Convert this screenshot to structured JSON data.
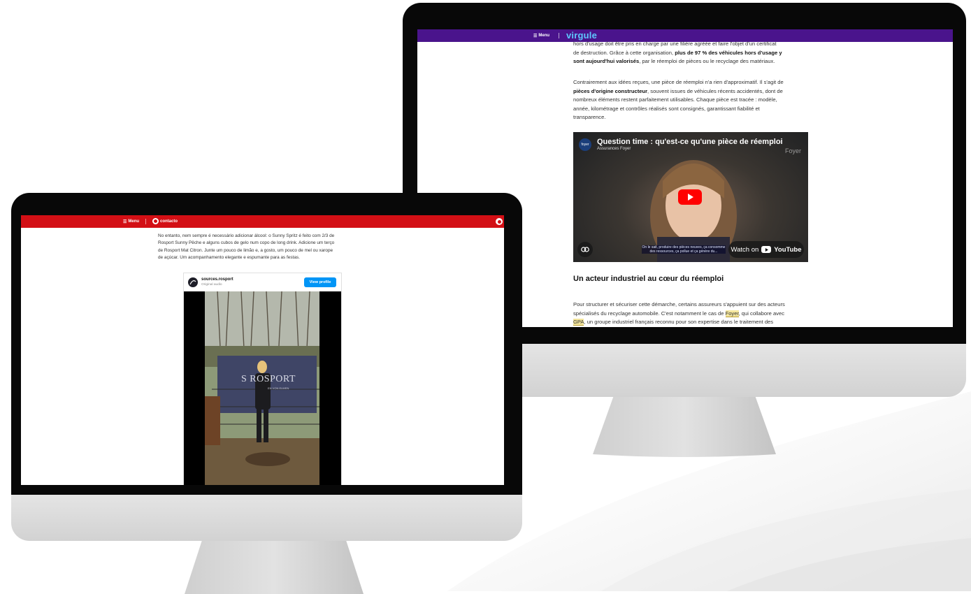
{
  "right_screen": {
    "header": {
      "menu_label": "Menu",
      "logo_text": "virgule",
      "brand_color": "#4a148c"
    },
    "article": {
      "p1": {
        "lines": [
          "hors d'usage doit être pris en charge par une filière agréée et faire l'objet d'un certificat",
          "de destruction. Grâce à cette organisation, "
        ],
        "bold_1": "plus de 97 % des véhicules hors d'usage y",
        "bold_2": "sont aujourd'hui valorisés",
        "end": ", par le réemploi de pièces ou le recyclage des matériaux."
      },
      "p2": {
        "start": "Contrairement aux idées reçues, une pièce de réemploi n'a rien d'approximatif. Il s'agit de",
        "bold": "pièces d'origine constructeur",
        "rest_1": ", souvent issues de véhicules récents accidentés, dont de",
        "line3": "nombreux éléments restent parfaitement utilisables. Chaque pièce est tracée : modèle,",
        "line4": "année, kilométrage et contrôles réalisés sont consignés, garantissant fiabilité et",
        "line5": "transparence."
      },
      "video": {
        "title": "Question time : qu'est-ce qu'une pièce de réemploi",
        "channel": "Assurances Foyer",
        "channel_logo": "foyer",
        "watermark": "Foyer",
        "caption_1": "On le sait, produire des pièces neuves, ça consomme",
        "caption_2": "des ressources, ça pollue et ça génère du...",
        "watch_label": "Watch on",
        "youtube_label": "YouTube"
      },
      "heading": "Un acteur industriel au cœur du réemploi",
      "p3": {
        "line1": "Pour structurer et sécuriser cette démarche, certains assureurs s'appuient sur des acteurs",
        "line2_a": "spécialisés du recyclage automobile. C'est notamment le cas de ",
        "link_foyer": "Foyer",
        "line2_b": ", qui collabore avec",
        "link_gpa": "GPA",
        "line3_b": ", un groupe industriel français reconnu pour son expertise dans le traitement des"
      }
    }
  },
  "left_screen": {
    "header": {
      "menu_label": "Menu",
      "logo_text": "contacto",
      "brand_color": "#d30f15"
    },
    "article": {
      "lines": [
        "No entanto, nem sempre é necessário adicionar álcool: o Sunny Spritz é feito com 2/3 de",
        "Rosport Sunny Pêche e alguns cubos de gelo num copo de long drink. Adicione um terço",
        "de Rosport Mat Citron. Junte um pouco de limão e, a gosto, um pouco de mel ou xarope",
        "de açúcar. Um acompanhamento elegante e espumante para as festas."
      ]
    },
    "instagram": {
      "account": "sources.rosport",
      "subtitle": "Original audio",
      "button": "View profile",
      "banner_text": "S ROSPORT",
      "banner_sub": "EN VON ELWEN"
    }
  }
}
